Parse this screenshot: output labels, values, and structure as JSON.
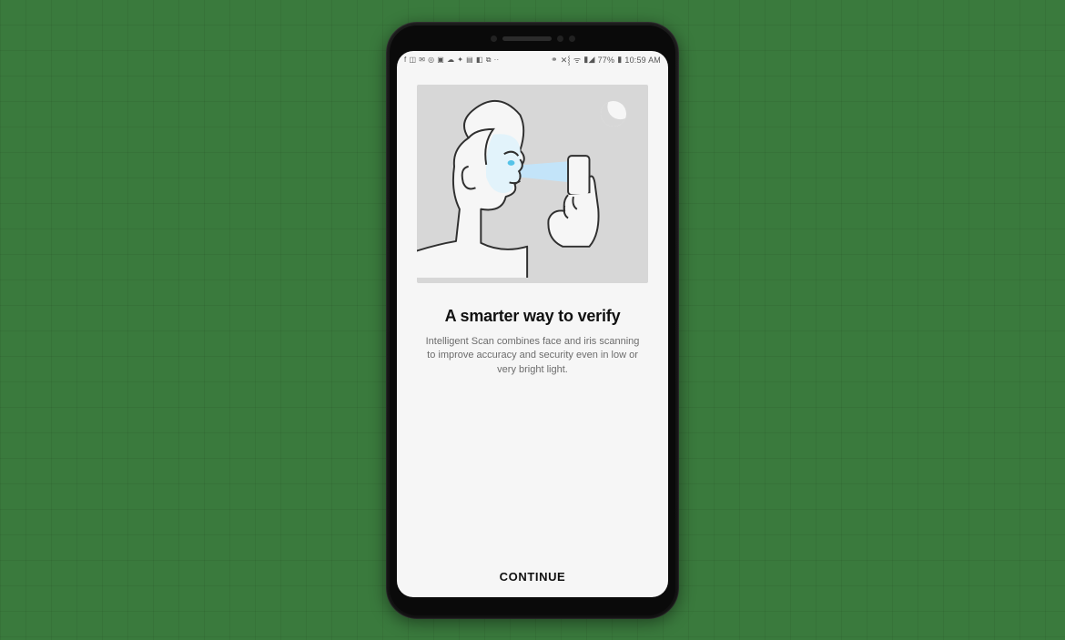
{
  "statusbar": {
    "left_icons": [
      "f",
      "◫",
      "✉",
      "◎",
      "▣",
      "☁",
      "✦",
      "▤",
      "◧",
      "⧉"
    ],
    "ellipsis": "··",
    "right": {
      "bluetooth": "⚭",
      "vibrate": "✕⸾",
      "wifi": "ᯤ",
      "signal": "▮◢",
      "battery_pct": "77%",
      "battery": "▮",
      "time": "10:59 AM"
    }
  },
  "screen": {
    "headline": "A smarter way to verify",
    "body": "Intelligent Scan combines face and iris scanning to improve accuracy and security even in low or very bright light.",
    "continue_label": "CONTINUE"
  },
  "illustration": {
    "moon_icon": "moon",
    "subject": "face-scan"
  }
}
